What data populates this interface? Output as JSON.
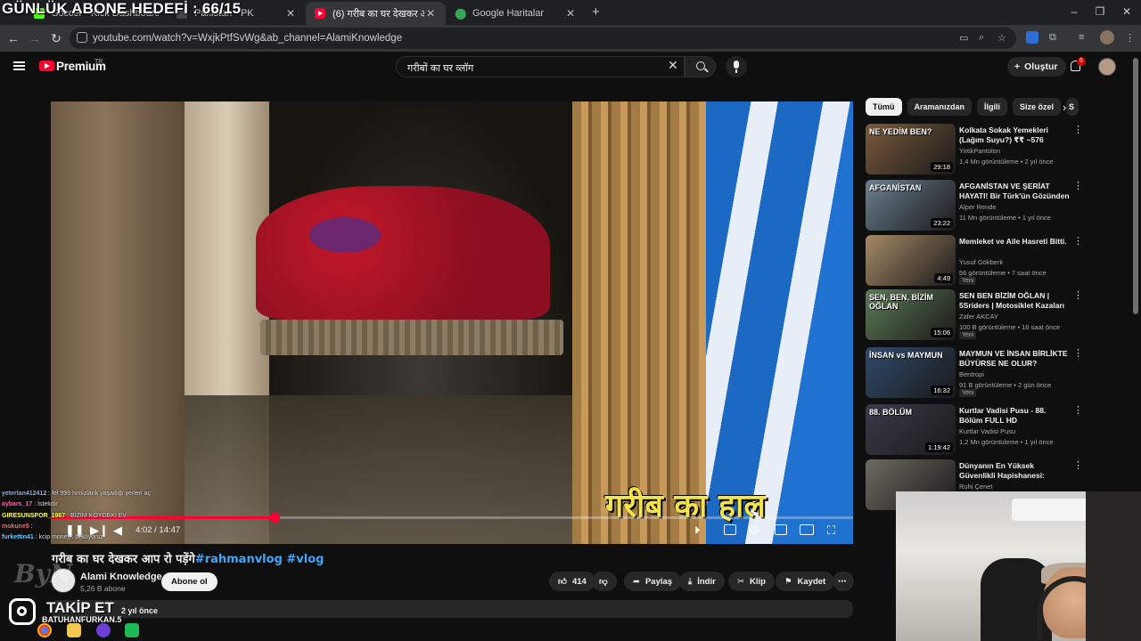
{
  "overlay": {
    "goal_text": "GÜNLÜK ABONE HEDEFİ : 66/15",
    "takip_text": "TAKİP ET",
    "takip_handle": "BATUHANFURKAN.5",
    "watermark": "ByN"
  },
  "browser": {
    "tabs": [
      {
        "title": "Soccer - Kick Dashboard",
        "active": false
      },
      {
        "title": "Pakistan - PK",
        "active": false
      },
      {
        "title": "(6) गरीब का घर देखकर आप रो पड़ेंगे",
        "active": true
      },
      {
        "title": "Google Haritalar",
        "active": false
      }
    ],
    "url": "youtube.com/watch?v=WxjkPtfSvWg&ab_channel=AlamiKnowledge",
    "window_controls": [
      "–",
      "❐",
      "✕"
    ]
  },
  "youtube": {
    "brand": "Premium",
    "region": "TR",
    "search_value": "गरीबों का घर व्लॉग",
    "create_label": "Oluştur",
    "notif_count": "6"
  },
  "player": {
    "caption": "गरीब का हाल",
    "time": "4:02 / 14:47",
    "progress_fraction": 0.279
  },
  "video": {
    "title": "गरीब का घर देखकर आप रो पड़ेंगे",
    "hashtags": "#rahmanvlog #vlog",
    "channel": "Alami Knowledge",
    "subscribers": "5,26 B abone",
    "subscribe_label": "Abone ol",
    "likes": "414",
    "share_label": "Paylaş",
    "download_label": "İndir",
    "clip_label": "Klip",
    "save_label": "Kaydet",
    "published": "2 yıl önce"
  },
  "sidebar": {
    "chips": [
      "Tümü",
      "Aramanızdan",
      "İlgili",
      "Size özel",
      "S"
    ],
    "recs": [
      {
        "title": "Kolkata Sokak Yemekleri (Lağım Suyu?) ₹₹ ~576",
        "channel": "YirtikPantolon",
        "meta": "1,4 Mn görüntüleme • 2 yıl önce",
        "duration": "29:18",
        "badge": "",
        "thumb_text": "NE YEDİM BEN?",
        "color": "#7b5a3c"
      },
      {
        "title": "AFGANİSTAN VE ŞERİAT HAYATI! Bir Türk'ün Gözünden ...",
        "channel": "Alper Rende",
        "meta": "11 Mn görüntüleme • 1 yıl önce",
        "duration": "23:22",
        "badge": "",
        "thumb_text": "AFGANİSTAN",
        "color": "#6b7f8e"
      },
      {
        "title": "Memleket ve Aile Hasreti Bitti.",
        "channel": "Yusuf Gökberk",
        "meta": "56 görüntüleme • 7 saat önce",
        "duration": "4:49",
        "badge": "Yeni",
        "thumb_text": "",
        "color": "#a68a66"
      },
      {
        "title": "SEN BEN BİZİM OĞLAN | 5Sriders | Motosiklet Kazaları ...",
        "channel": "Zafer AKCAY",
        "meta": "100 B görüntüleme • 16 saat önce",
        "duration": "15:06",
        "badge": "Yeni",
        "thumb_text": "SEN, BEN, BİZİM OĞLAN",
        "color": "#5c7a55"
      },
      {
        "title": "MAYMUN VE İNSAN BİRLİKTE BÜYÜRSE NE OLUR?",
        "channel": "Bentropi",
        "meta": "91 B görüntüleme • 2 gün önce",
        "duration": "16:32",
        "badge": "Yeni",
        "thumb_text": "İNSAN vs MAYMUN",
        "color": "#2f4a6a"
      },
      {
        "title": "Kurtlar Vadisi Pusu - 88. Bölüm FULL HD",
        "channel": "Kurtlar Vadisi Pusu",
        "meta": "1,2 Mn görüntüleme • 1 yıl önce",
        "duration": "1:19:42",
        "badge": "",
        "thumb_text": "88. BÖLÜM",
        "color": "#3b3a4a"
      },
      {
        "title": "Dünyanın En Yüksek Güvenlikli Hapishanesi: CECOT (Şeytanla...",
        "channel": "Ruhi Çenet",
        "meta": "",
        "duration": "",
        "badge": "",
        "thumb_text": "",
        "color": "#6d6a60"
      }
    ]
  },
  "chat": [
    {
      "user": "yeterlan412412",
      "msg": "fel 999 himizlank yaşadığı yerleri aç",
      "color": "#9ad"
    },
    {
      "user": "aybars_17",
      "msg": "İstekdir",
      "color": "#f6a"
    },
    {
      "user": "GIRESUNSPOR_1967",
      "msg": "BİZİM KÖYDEKİ EV",
      "color": "#ff6"
    },
    {
      "user": "mokune5",
      "msg": "",
      "color": "#f66"
    },
    {
      "user": "furkettin41",
      "msg": "kcip money.. bekliyoruz",
      "color": "#6cf"
    }
  ]
}
